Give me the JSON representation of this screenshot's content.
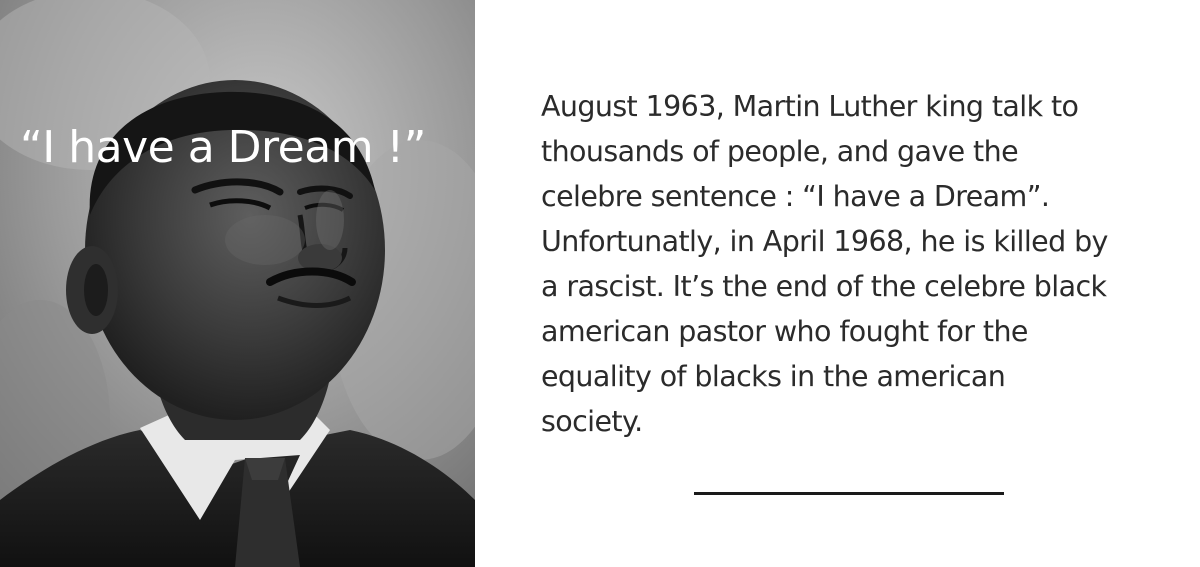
{
  "photo": {
    "caption_overlay": "“I have a Dream !”"
  },
  "text_block": {
    "lines": [
      "August 1963, Martin Luther king talk to",
      "thousands of people, and gave the",
      "celebre sentence : “I have a Dream”.",
      "Unfortunatly, in April 1968, he is killed by",
      "a rascist. It’s the end of the celebre black",
      "american pastor who fought for the",
      "equality of blacks in the american",
      "society."
    ]
  },
  "colors": {
    "background": "#ffffff",
    "text": "#2b2b2b",
    "overlay_text": "#ffffff",
    "divider": "#1a1a1a"
  }
}
